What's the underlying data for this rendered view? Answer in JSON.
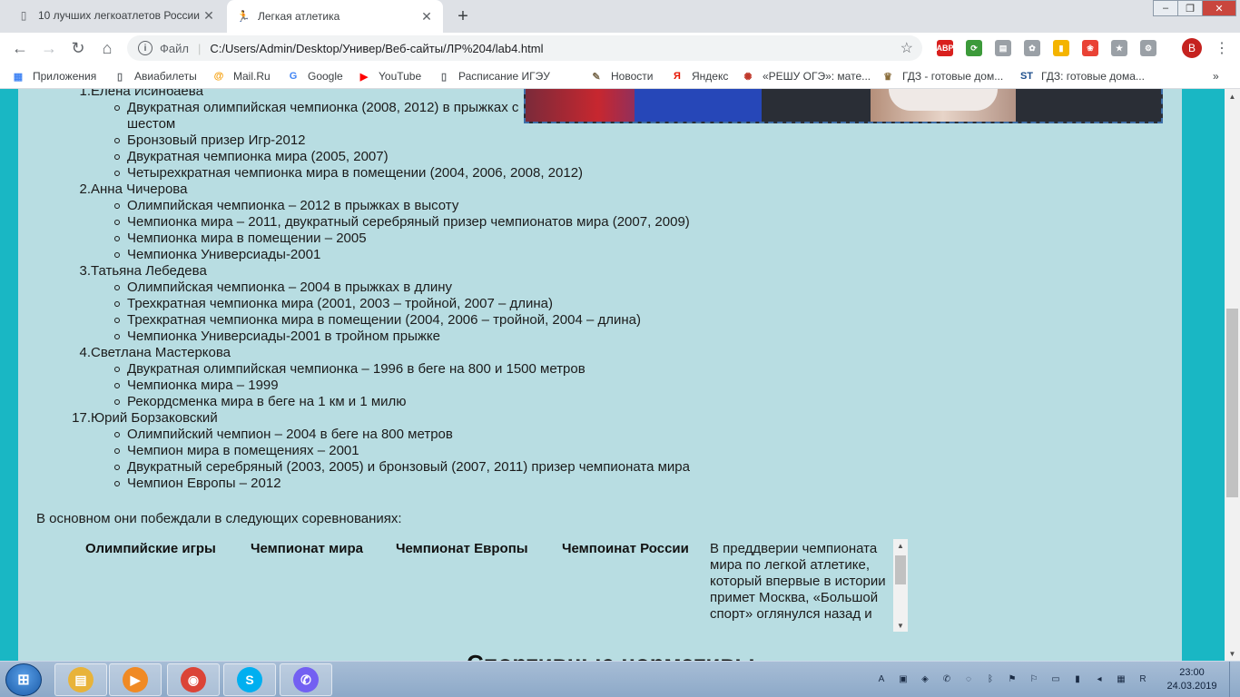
{
  "browser": {
    "tabs": [
      {
        "title": "10 лучших легкоатлетов России",
        "active": false,
        "favicon": "page-icon"
      },
      {
        "title": "Легкая атлетика",
        "active": true,
        "favicon": "runner-icon"
      }
    ],
    "window_controls": {
      "minimize": "–",
      "restore": "❐",
      "close": "✕"
    },
    "address": {
      "scheme_label": "Файл",
      "url": "C:/Users/Admin/Desktop/Универ/Веб-сайты/ЛР%204/lab4.html"
    },
    "extensions": [
      {
        "name": "abp-icon",
        "label": "ABP",
        "color": "#d9201e"
      },
      {
        "name": "sync-icon",
        "label": "⟳",
        "color": "#3c9a3a"
      },
      {
        "name": "pdf-icon",
        "label": "▤",
        "color": "#9aa0a6"
      },
      {
        "name": "gear-ext-icon",
        "label": "✿",
        "color": "#9aa0a6"
      },
      {
        "name": "colorful-ext-icon",
        "label": "▮",
        "color": "#f4b400"
      },
      {
        "name": "flower-ext-icon",
        "label": "❀",
        "color": "#e94235"
      },
      {
        "name": "bookmark-ext-icon",
        "label": "★",
        "color": "#9aa0a6"
      },
      {
        "name": "puzzle-ext-icon",
        "label": "⚙",
        "color": "#9aa0a6"
      }
    ],
    "profile_initial": "B",
    "bookmarks": [
      {
        "label": "Приложения",
        "icon": "apps-grid-icon"
      },
      {
        "label": "Авиабилеты",
        "icon": "page-icon"
      },
      {
        "label": "Mail.Ru",
        "icon": "mailru-icon"
      },
      {
        "label": "Google",
        "icon": "google-icon"
      },
      {
        "label": "YouTube",
        "icon": "youtube-icon"
      },
      {
        "label": "Расписание ИГЭУ",
        "icon": "page-icon"
      },
      {
        "label": "Новости",
        "icon": "news-icon"
      },
      {
        "label": "Яндекс",
        "icon": "yandex-icon"
      },
      {
        "label": "«РЕШУ ОГЭ»: мате...",
        "icon": "reshu-icon"
      },
      {
        "label": "ГДЗ - готовые дом...",
        "icon": "gdz-icon"
      },
      {
        "label": "ГДЗ: готовые дома...",
        "icon": "st-icon"
      }
    ],
    "bookmarks_overflow": "»"
  },
  "page": {
    "athletes": [
      {
        "number": "1.",
        "name": "Елена Исинбаева",
        "achievements": [
          "Двукратная олимпийская чемпионка (2008, 2012) в прыжках с шестом",
          "Бронзовый призер Игр-2012",
          "Двукратная чемпионка мира (2005, 2007)",
          "Четырехкратная чемпионка мира в помещении (2004, 2006, 2008, 2012)"
        ]
      },
      {
        "number": "2.",
        "name": "Анна Чичерова",
        "achievements": [
          "Олимпийская чемпионка – 2012 в прыжках в высоту",
          "Чемпионка мира – 2011, двукратный серебряный призер чемпионатов мира (2007, 2009)",
          "Чемпионка мира в помещении – 2005",
          "Чемпионка Универсиады-2001"
        ]
      },
      {
        "number": "3.",
        "name": "Татьяна Лебедева",
        "achievements": [
          "Олимпийская чемпионка – 2004 в прыжках в длину",
          "Трехкратная чемпионка мира (2001, 2003 – тройной, 2007 – длина)",
          "Трехкратная чемпионка мира в помещении (2004, 2006 – тройной, 2004 – длина)",
          "Чемпионка Универсиады-2001 в тройном прыжке"
        ]
      },
      {
        "number": "4.",
        "name": "Светлана Мастеркова",
        "achievements": [
          "Двукратная олимпийская чемпионка – 1996 в беге на 800 и 1500 метров",
          "Чемпионка мира – 1999",
          "Рекордсменка мира в беге на 1 км и 1 милю"
        ]
      },
      {
        "number": "17.",
        "name": "Юрий Борзаковский",
        "achievements": [
          "Олимпийский чемпион – 2004 в беге на 800 метров",
          "Чемпион мира в помещениях – 2001",
          "Двукратный серебряный (2003, 2005) и бронзовый (2007, 2011) призер чемпионата мира",
          "Чемпион Европы – 2012"
        ]
      }
    ],
    "intro": "В основном они побеждали в следующих соревнованиях:",
    "competitions": [
      "Олимпийские игры",
      "Чемпионат мира",
      "Чемпионат Европы",
      "Чемпоинат России"
    ],
    "scroll_text": "В преддверии чемпионата мира по легкой атлетике, который впервые в истории примет Москва, «Большой спорт» оглянулся назад и",
    "next_heading": "Спортивные нормативы"
  },
  "taskbar": {
    "apps": [
      {
        "name": "explorer-icon",
        "color": "#e8b33a"
      },
      {
        "name": "media-player-icon",
        "color": "#f08a24"
      },
      {
        "name": "chrome-icon",
        "color": "#db4437"
      },
      {
        "name": "skype-icon",
        "color": "#00aff0"
      },
      {
        "name": "viber-icon",
        "color": "#7360f2"
      }
    ],
    "time": "23:00",
    "date": "24.03.2019"
  }
}
